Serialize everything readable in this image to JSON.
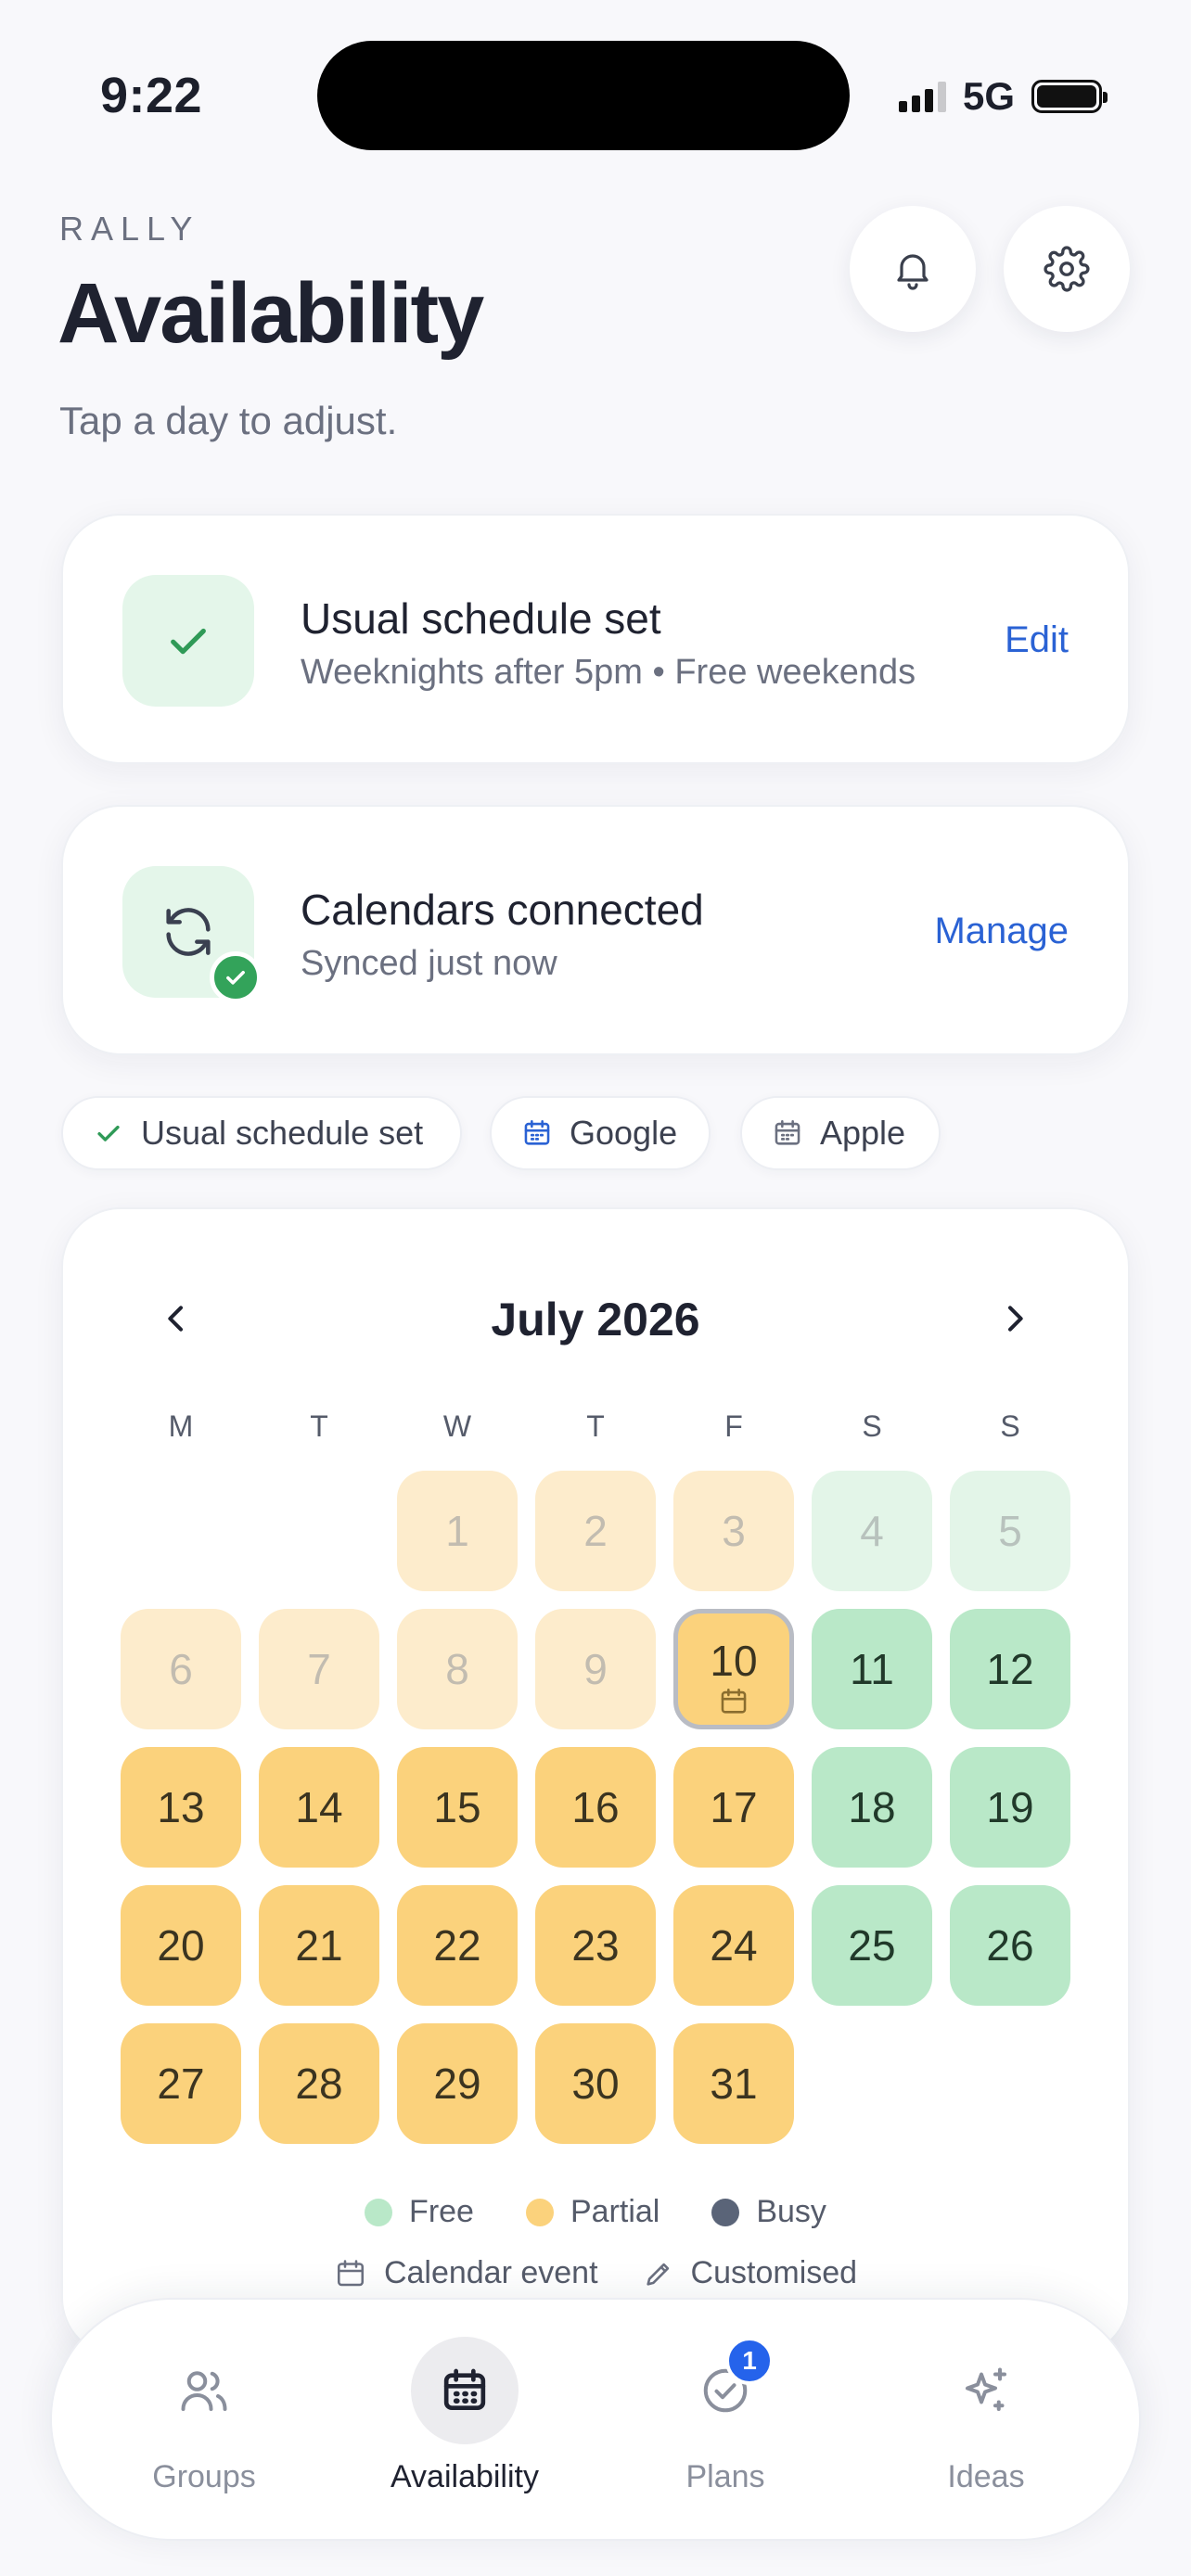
{
  "status_bar": {
    "time": "9:22",
    "network": "5G"
  },
  "header": {
    "brand": "RALLY",
    "title": "Availability",
    "subtitle": "Tap a day to adjust."
  },
  "schedule_card": {
    "title": "Usual schedule set",
    "subtitle": "Weeknights after 5pm • Free weekends",
    "action": "Edit"
  },
  "calendars_card": {
    "title": "Calendars connected",
    "subtitle": "Synced just now",
    "action": "Manage"
  },
  "chips": [
    {
      "label": "Usual schedule set",
      "icon": "check-icon"
    },
    {
      "label": "Google",
      "icon": "calendar-icon"
    },
    {
      "label": "Apple",
      "icon": "calendar-icon"
    }
  ],
  "calendar": {
    "month": "July 2026",
    "weekdays": [
      "M",
      "T",
      "W",
      "T",
      "F",
      "S",
      "S"
    ],
    "leading_blanks": 2,
    "days": [
      {
        "d": "1",
        "s": "past-partial"
      },
      {
        "d": "2",
        "s": "past-partial"
      },
      {
        "d": "3",
        "s": "past-partial"
      },
      {
        "d": "4",
        "s": "past-free"
      },
      {
        "d": "5",
        "s": "past-free"
      },
      {
        "d": "6",
        "s": "past-partial"
      },
      {
        "d": "7",
        "s": "past-partial"
      },
      {
        "d": "8",
        "s": "past-partial"
      },
      {
        "d": "9",
        "s": "past-partial"
      },
      {
        "d": "10",
        "s": "today",
        "event": true
      },
      {
        "d": "11",
        "s": "free"
      },
      {
        "d": "12",
        "s": "free"
      },
      {
        "d": "13",
        "s": "partial"
      },
      {
        "d": "14",
        "s": "partial"
      },
      {
        "d": "15",
        "s": "partial"
      },
      {
        "d": "16",
        "s": "partial"
      },
      {
        "d": "17",
        "s": "partial"
      },
      {
        "d": "18",
        "s": "free"
      },
      {
        "d": "19",
        "s": "free"
      },
      {
        "d": "20",
        "s": "partial"
      },
      {
        "d": "21",
        "s": "partial"
      },
      {
        "d": "22",
        "s": "partial"
      },
      {
        "d": "23",
        "s": "partial"
      },
      {
        "d": "24",
        "s": "partial"
      },
      {
        "d": "25",
        "s": "free"
      },
      {
        "d": "26",
        "s": "free"
      },
      {
        "d": "27",
        "s": "partial"
      },
      {
        "d": "28",
        "s": "partial"
      },
      {
        "d": "29",
        "s": "partial"
      },
      {
        "d": "30",
        "s": "partial"
      },
      {
        "d": "31",
        "s": "partial"
      }
    ]
  },
  "legend": {
    "free": "Free",
    "partial": "Partial",
    "busy": "Busy",
    "calendar_event": "Calendar event",
    "customised": "Customised"
  },
  "colors": {
    "free": "#b9e8c8",
    "partial": "#fbd27c",
    "busy": "#5a6478",
    "accent": "#2a62d4",
    "badge": "#2563eb"
  },
  "tabs": [
    {
      "label": "Groups",
      "icon": "users-icon"
    },
    {
      "label": "Availability",
      "icon": "calendar-icon",
      "active": true
    },
    {
      "label": "Plans",
      "icon": "check-circle-icon",
      "badge": "1"
    },
    {
      "label": "Ideas",
      "icon": "sparkle-icon"
    }
  ]
}
